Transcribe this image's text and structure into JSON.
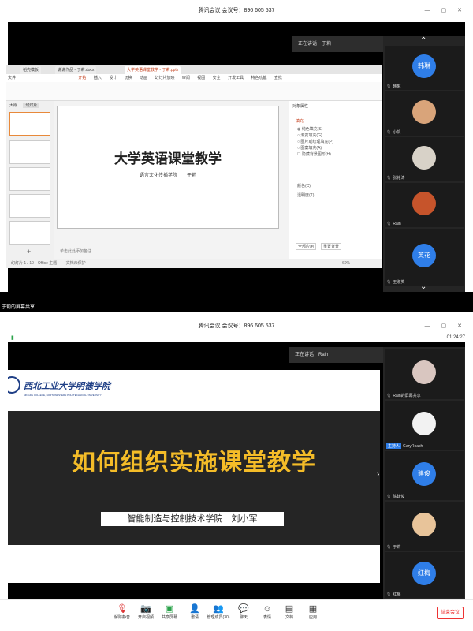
{
  "top": {
    "window_title": "腾讯会议 会议号：896 605 537",
    "speaking": "正在讲话：于莉",
    "share_caption": "于莉的屏幕共享",
    "app": {
      "tabs": [
        "稻壳模板",
        "说说作品 - 于莉.docx",
        "大学英语课堂教学 - 于莉.pptx"
      ],
      "menus": [
        "文件",
        "开始",
        "插入",
        "设计",
        "切换",
        "动画",
        "幻灯片放映",
        "审阅",
        "视图",
        "安全",
        "开发工具",
        "特色功能",
        "查找"
      ],
      "thumbs_header": [
        "大纲",
        "幻灯片"
      ],
      "slide_title": "大学英语课堂教学",
      "slide_subtitle": "语言文化传播学院　　于莉",
      "notes": "单击此处添加备注",
      "status_left": "幻灯片 1 / 10　Office 主题",
      "status_mid": "文档未保护",
      "zoom": "60%",
      "side_title": "对象属性",
      "side_section": "填充",
      "side_options": [
        "纯色填充(S)",
        "渐变填充(G)",
        "图片或纹理填充(P)",
        "图案填充(A)",
        "隐藏背景图形(H)"
      ],
      "side_labels": [
        "颜色(C)",
        "透明度(T)"
      ],
      "side_buttons": [
        "全部应用",
        "重置背景"
      ]
    },
    "participants": [
      {
        "name": "韩琳",
        "kind": "avatar",
        "label": "韩琳",
        "color": "#2f7ee8"
      },
      {
        "name": "小凯",
        "kind": "photo",
        "color": "#d9a47a"
      },
      {
        "name": "张铭涛",
        "kind": "photo",
        "color": "#d8d2c8"
      },
      {
        "name": "Rain",
        "kind": "photo",
        "color": "#c6542b"
      },
      {
        "name": "王淑英",
        "kind": "avatar",
        "label": "英花",
        "color": "#2f7ee8"
      }
    ]
  },
  "bottom": {
    "window_title": "腾讯会议 会议号：896 605 537",
    "timer": "01:24:27",
    "speaking": "正在讲话：Rain",
    "slide": {
      "logo_cn": "西北工业大学明德学院",
      "logo_en": "MINGDE COLLEGE, NORTHWESTERN POLYTECHNICAL UNIVERSITY",
      "title": "如何组织实施课堂教学",
      "subtitle": "智能制造与控制技术学院　刘小军"
    },
    "participants": [
      {
        "name": "Rain的屏幕共享",
        "kind": "photo",
        "color": "#d9c6c0"
      },
      {
        "name": "GaryRoach",
        "kind": "photo",
        "color": "#f2f2f2",
        "tag": "主持人"
      },
      {
        "name": "陈建俊",
        "kind": "avatar",
        "label": "建俊",
        "color": "#2f7ee8"
      },
      {
        "name": "于莉",
        "kind": "photo",
        "color": "#e8c49a"
      },
      {
        "name": "红梅",
        "kind": "avatar",
        "label": "红梅",
        "color": "#2f7ee8"
      }
    ],
    "toolbar": [
      {
        "label": "解除静音",
        "icon": "mic-off-icon",
        "glyph": "🎙"
      },
      {
        "label": "开启视频",
        "icon": "camera-off-icon",
        "glyph": "📷"
      },
      {
        "label": "共享屏幕",
        "icon": "share-screen-icon",
        "glyph": "▣"
      },
      {
        "label": "邀请",
        "icon": "invite-icon",
        "glyph": "👤"
      },
      {
        "label": "管理成员(30)",
        "icon": "members-icon",
        "glyph": "👥"
      },
      {
        "label": "聊天",
        "icon": "chat-icon",
        "glyph": "💬"
      },
      {
        "label": "表情",
        "icon": "emoji-icon",
        "glyph": "☺"
      },
      {
        "label": "文档",
        "icon": "document-icon",
        "glyph": "▤"
      },
      {
        "label": "应用",
        "icon": "apps-icon",
        "glyph": "▦"
      }
    ],
    "end_button": "结束会议"
  }
}
